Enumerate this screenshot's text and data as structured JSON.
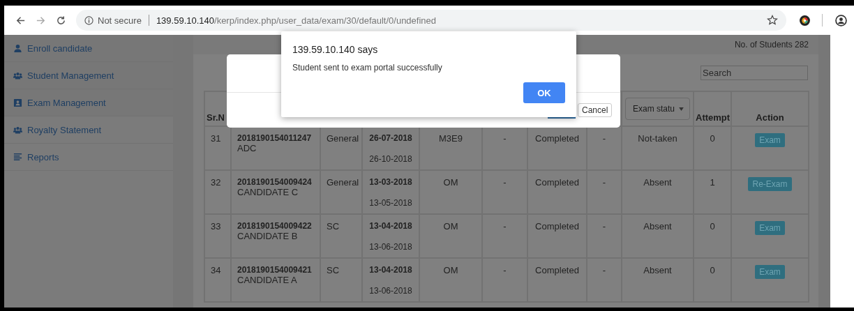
{
  "browser": {
    "security_label": "Not secure",
    "url_host": "139.59.10.140",
    "url_path": "/kerp/index.php/user_data/exam/30/default/0/undefined"
  },
  "sidebar": {
    "items": [
      {
        "label": "Enroll candidate",
        "kind": "user"
      },
      {
        "label": "Student Management",
        "kind": "users"
      },
      {
        "label": "Exam Management",
        "kind": "book"
      },
      {
        "label": "Royalty Statement",
        "kind": "users"
      },
      {
        "label": "Reports",
        "kind": "list"
      }
    ]
  },
  "header": {
    "student_count": "No. of Students 282",
    "search": {
      "placeholder": "Search"
    }
  },
  "table": {
    "sr_label": "Sr.N",
    "status_filter": "Exam statu",
    "attempt_label": "Attempt",
    "action_label": "Action",
    "rows": [
      {
        "sr": "31",
        "id": "2018190154011247",
        "name": "ADC",
        "category": "General",
        "date_from": "26-07-2018",
        "date_to": "26-10-2018",
        "column_5": "M3E9",
        "column_6": "-",
        "column_7": "Completed",
        "column_8": "-",
        "exam_status": "Not-taken",
        "attempt": "0",
        "action": "Exam"
      },
      {
        "sr": "32",
        "id": "2018190154009424",
        "name": "CANDIDATE C",
        "category": "General",
        "date_from": "13-03-2018",
        "date_to": "13-05-2018",
        "column_5": "OM",
        "column_6": "-",
        "column_7": "Completed",
        "column_8": "-",
        "exam_status": "Absent",
        "attempt": "1",
        "action": "Re-Exam"
      },
      {
        "sr": "33",
        "id": "2018190154009422",
        "name": "CANDIDATE B",
        "category": "SC",
        "date_from": "13-04-2018",
        "date_to": "13-06-2018",
        "column_5": "OM",
        "column_6": "-",
        "column_7": "Completed",
        "column_8": "-",
        "exam_status": "Absent",
        "attempt": "0",
        "action": "Exam"
      },
      {
        "sr": "34",
        "id": "2018190154009421",
        "name": "CANDIDATE A",
        "category": "SC",
        "date_from": "13-04-2018",
        "date_to": "13-06-2018",
        "column_5": "OM",
        "column_6": "-",
        "column_7": "Completed",
        "column_8": "-",
        "exam_status": "Absent",
        "attempt": "0",
        "action": "Exam"
      }
    ]
  },
  "modal": {
    "cancel_label": "Cancel"
  },
  "alert": {
    "origin": "139.59.10.140 says",
    "message": "Student sent to exam portal successfully",
    "ok_label": "OK"
  }
}
